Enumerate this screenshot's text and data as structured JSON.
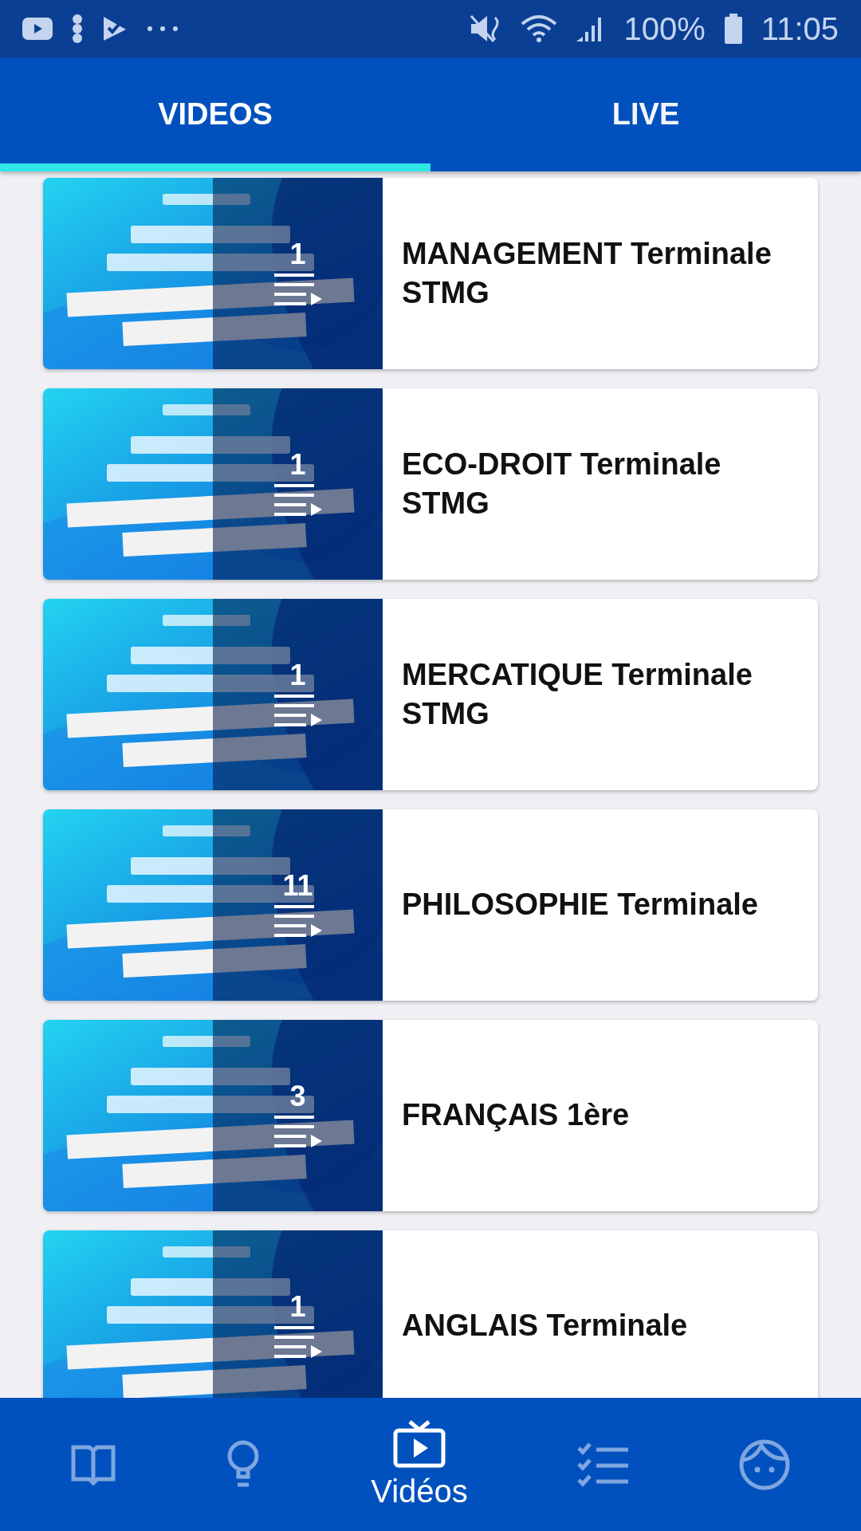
{
  "status_bar": {
    "battery": "100%",
    "time": "11:05"
  },
  "tabs": [
    {
      "label": "VIDEOS",
      "selected": true
    },
    {
      "label": "LIVE",
      "selected": false
    }
  ],
  "playlists": [
    {
      "count": "1",
      "title": "MANAGEMENT Terminale STMG"
    },
    {
      "count": "1",
      "title": "ECO-DROIT Terminale STMG"
    },
    {
      "count": "1",
      "title": "MERCATIQUE Terminale STMG"
    },
    {
      "count": "11",
      "title": "PHILOSOPHIE Terminale"
    },
    {
      "count": "3",
      "title": "FRANÇAIS 1ère"
    },
    {
      "count": "1",
      "title": "ANGLAIS Terminale"
    }
  ],
  "bottom_nav": [
    {
      "selected": false
    },
    {
      "selected": false
    },
    {
      "selected": true,
      "label": "Vidéos"
    },
    {
      "selected": false
    },
    {
      "selected": false
    }
  ]
}
